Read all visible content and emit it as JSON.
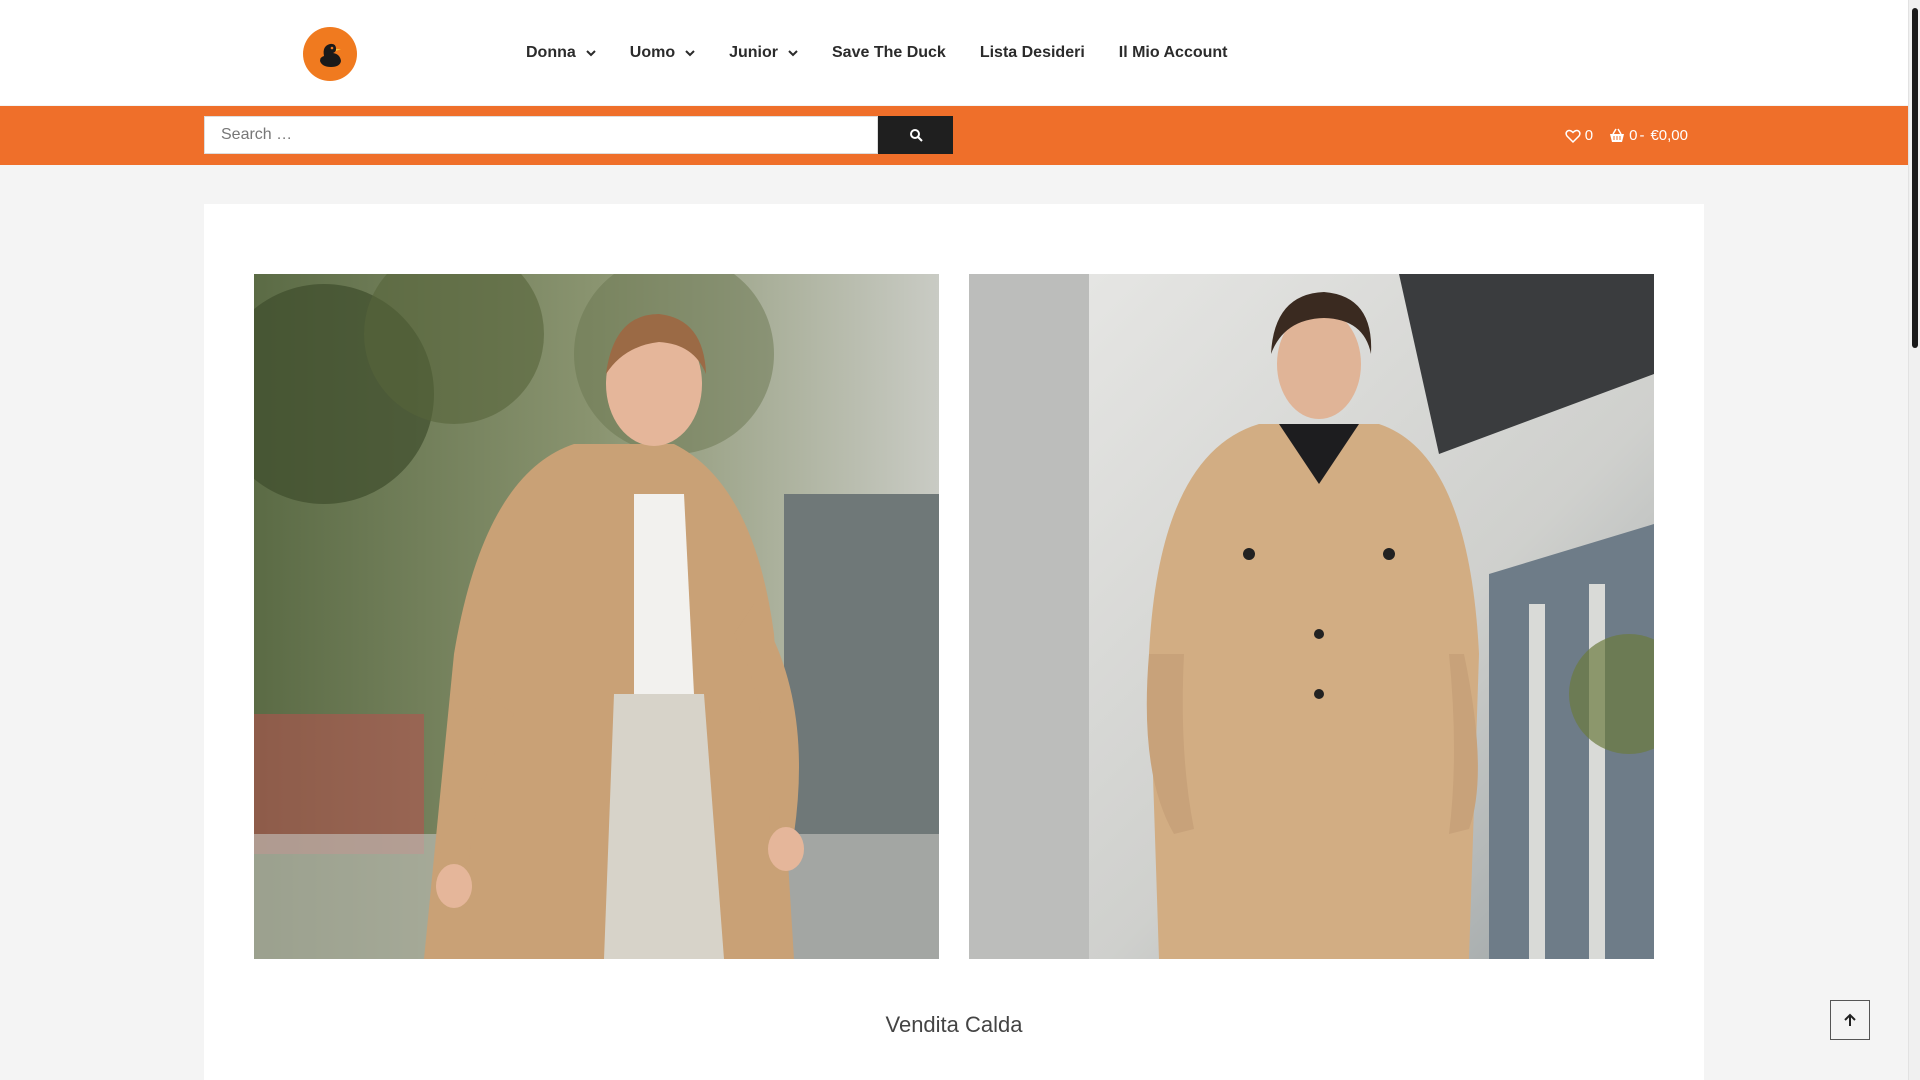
{
  "header": {
    "logo_name": "duck-logo",
    "nav": [
      {
        "label": "Donna",
        "has_dropdown": true
      },
      {
        "label": "Uomo",
        "has_dropdown": true
      },
      {
        "label": "Junior",
        "has_dropdown": true
      },
      {
        "label": "Save The Duck",
        "has_dropdown": false
      },
      {
        "label": "Lista Desideri",
        "has_dropdown": false
      },
      {
        "label": "Il Mio Account",
        "has_dropdown": false
      }
    ]
  },
  "toolbar": {
    "search_placeholder": "Search …",
    "wishlist_count": "0",
    "cart_count": "0",
    "cart_separator": "-",
    "cart_total": "€0,00"
  },
  "main": {
    "section_title": "Vendita Calda",
    "images": [
      {
        "subject": "woman-in-beige-trench-coat"
      },
      {
        "subject": "man-in-beige-shirt-jacket-and-shorts"
      }
    ]
  },
  "colors": {
    "accent": "#ef6f2a",
    "logo_bg": "#f07a1f",
    "search_button": "#1f1f1f",
    "card_bg": "#ffffff",
    "page_bg": "#f4f4f4"
  }
}
